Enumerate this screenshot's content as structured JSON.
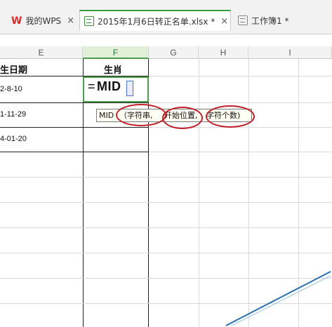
{
  "tabs": [
    {
      "label": "我的WPS",
      "close": "×"
    },
    {
      "label": "2015年1月6日转正名单.xlsx *",
      "close": "×"
    },
    {
      "label": "工作簿1 *"
    }
  ],
  "columns": [
    "E",
    "F",
    "G",
    "H",
    "I"
  ],
  "cells": {
    "E_header": "生日期",
    "F_header": "生肖",
    "E_row1": "2-8-10",
    "E_row2": "1-11-29",
    "E_row3": "4-01-20"
  },
  "formula": {
    "eq": "=",
    "text": "MID"
  },
  "tooltip": {
    "func": "MID",
    "arg1": "（字符串,",
    "arg2": "开始位置,",
    "arg3": "字符个数)"
  },
  "colors": {
    "accent": "#4c9e4c",
    "annotation": "#c0202a"
  }
}
